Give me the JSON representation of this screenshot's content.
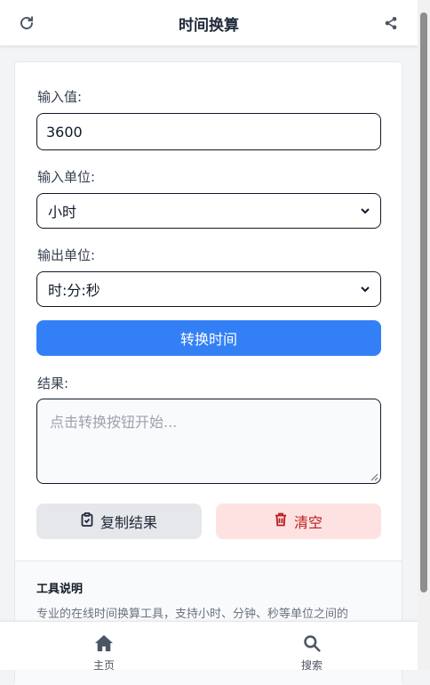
{
  "header": {
    "title": "时间换算",
    "left_icon": "refresh-icon",
    "right_icon": "share-icon"
  },
  "form": {
    "input_value_label": "输入值:",
    "input_value": "3600",
    "input_unit_label": "输入单位:",
    "input_unit_selected": "小时",
    "output_unit_label": "输出单位:",
    "output_unit_selected": "时:分:秒",
    "convert_button": "转换时间",
    "result_label": "结果:",
    "result_placeholder": "点击转换按钮开始..."
  },
  "actions": {
    "copy_label": "复制结果",
    "clear_label": "清空"
  },
  "info": {
    "title": "工具说明",
    "text": "专业的在线时间换算工具，支持小时、分钟、秒等单位之间的"
  },
  "bottom_nav": {
    "items": [
      {
        "label": "主页",
        "icon": "home-icon"
      },
      {
        "label": "搜索",
        "icon": "search-icon"
      }
    ]
  },
  "colors": {
    "primary": "#3380f6",
    "danger_bg": "#fee2e2",
    "danger_text": "#b91c1c",
    "secondary_bg": "#e5e7eb"
  }
}
